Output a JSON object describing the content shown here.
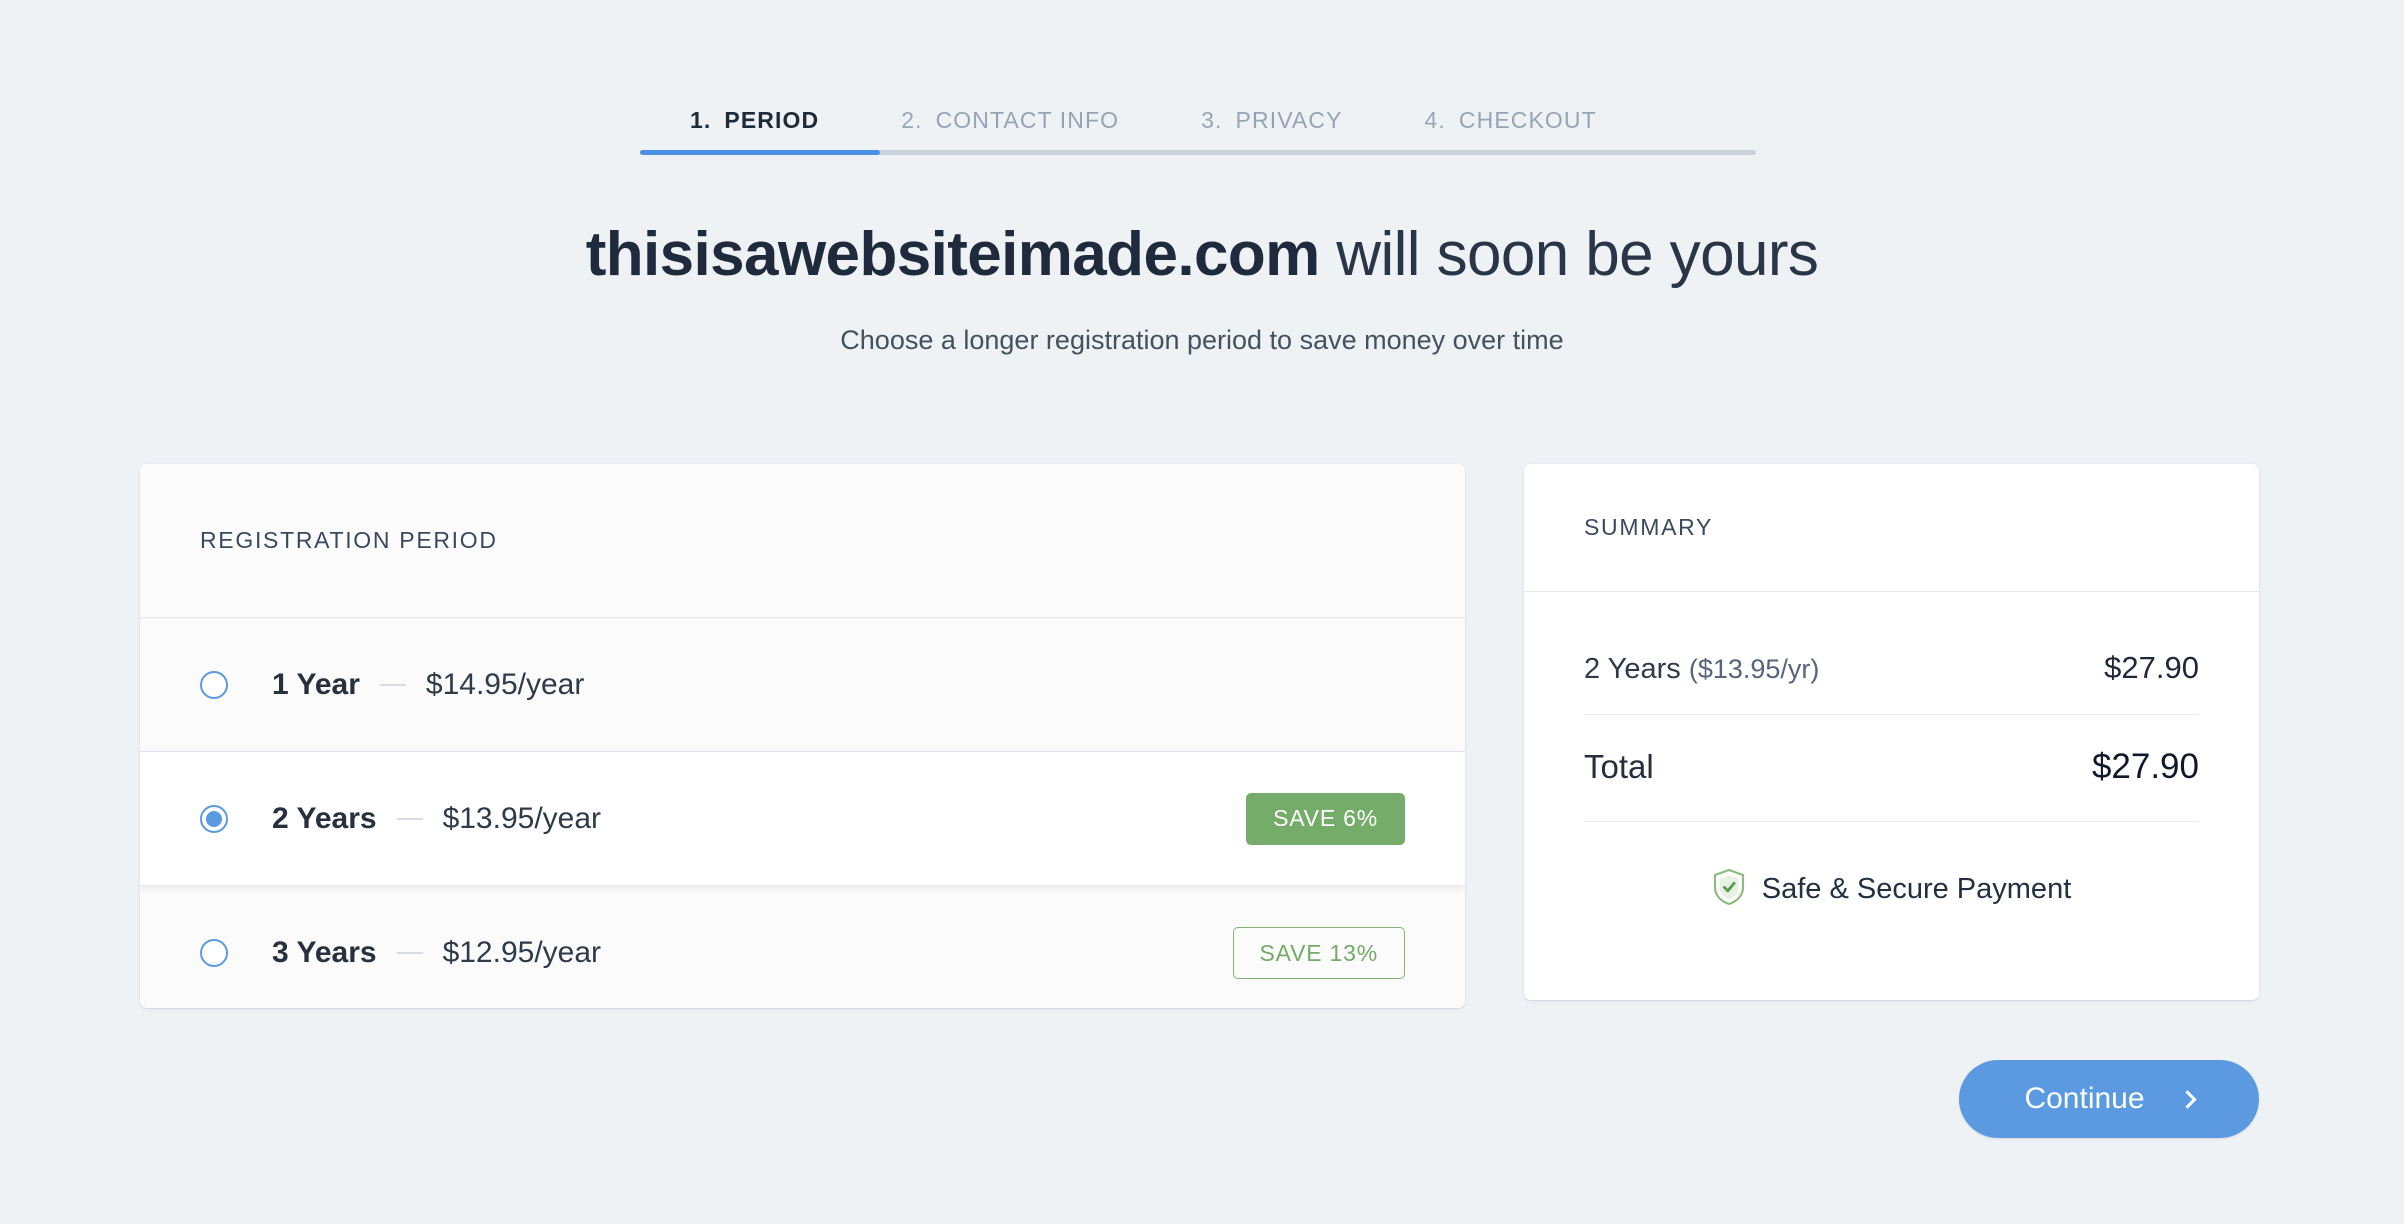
{
  "stepper": {
    "steps": [
      {
        "num": "1.",
        "label": "PERIOD",
        "active": true
      },
      {
        "num": "2.",
        "label": "CONTACT INFO",
        "active": false
      },
      {
        "num": "3.",
        "label": "PRIVACY",
        "active": false
      },
      {
        "num": "4.",
        "label": "CHECKOUT",
        "active": false
      }
    ],
    "progress_percent": 21.5,
    "progress_fill_color": "#4a90e2",
    "progress_track_color": "#ccd3da"
  },
  "headline": {
    "domain": "thisisawebsiteimade.com",
    "rest": " will soon be yours",
    "subtitle": "Choose a longer registration period to save money over time"
  },
  "period_card": {
    "title": "REGISTRATION PERIOD",
    "options": [
      {
        "term": "1 Year",
        "price": "$14.95/year",
        "selected": false,
        "badge": null,
        "badge_style": null
      },
      {
        "term": "2 Years",
        "price": "$13.95/year",
        "selected": true,
        "badge": "SAVE 6%",
        "badge_style": "solid"
      },
      {
        "term": "3 Years",
        "price": "$12.95/year",
        "selected": false,
        "badge": "SAVE 13%",
        "badge_style": "outline"
      }
    ]
  },
  "summary_card": {
    "title": "SUMMARY",
    "line_item_term": "2 Years",
    "line_item_rate": "($13.95/yr)",
    "line_item_amount": "$27.90",
    "total_label": "Total",
    "total_amount": "$27.90",
    "secure_text": "Safe & Secure Payment"
  },
  "continue_button": {
    "label": "Continue",
    "color": "#5b9ae0"
  },
  "colors": {
    "page_background": "#eef2f5",
    "accent_blue": "#5b9ae0",
    "badge_green": "#76ac6a",
    "badge_green_outline": "#74ab68",
    "text_dark": "#27303d",
    "text_muted": "#97a3b4"
  }
}
